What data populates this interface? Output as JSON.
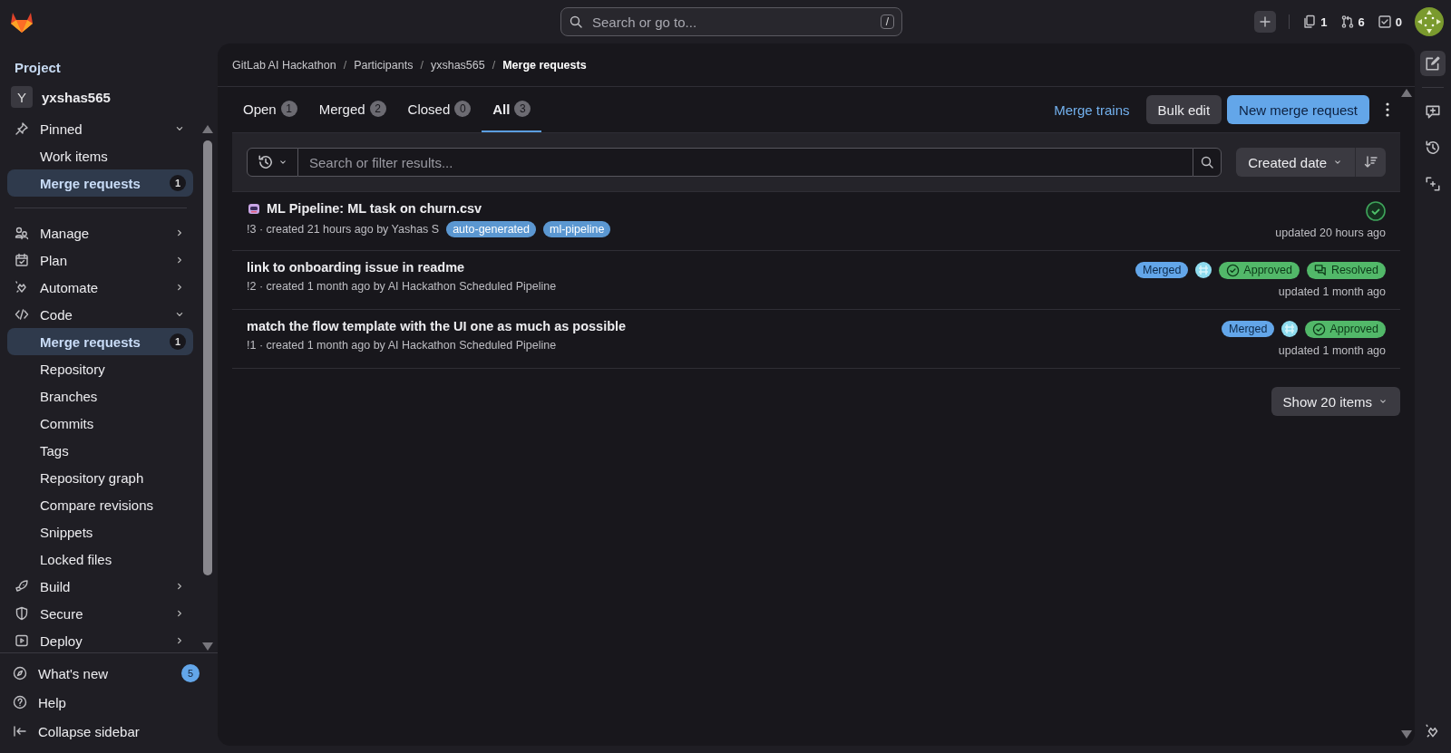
{
  "search": {
    "placeholder": "Search or go to...",
    "shortcut": "/"
  },
  "top_counts": [
    {
      "kind": "issues",
      "count": "1"
    },
    {
      "kind": "merge",
      "count": "6"
    },
    {
      "kind": "todo",
      "count": "0"
    }
  ],
  "sidebar": {
    "title": "Project",
    "project": {
      "initial": "Y",
      "name": "yxshas565"
    },
    "items": [
      {
        "kind": "section",
        "label": "Pinned",
        "expanded": true,
        "children": [
          {
            "label": "Work items",
            "selected": false
          },
          {
            "label": "Merge requests",
            "selected": true,
            "badge": "1"
          }
        ]
      },
      {
        "kind": "divider"
      },
      {
        "kind": "section",
        "label": "Manage",
        "expanded": false
      },
      {
        "kind": "section",
        "label": "Plan",
        "expanded": false
      },
      {
        "kind": "section",
        "label": "Automate",
        "expanded": false
      },
      {
        "kind": "section",
        "label": "Code",
        "expanded": true,
        "children": [
          {
            "label": "Merge requests",
            "selected": true,
            "badge": "1"
          },
          {
            "label": "Repository",
            "selected": false
          },
          {
            "label": "Branches",
            "selected": false
          },
          {
            "label": "Commits",
            "selected": false
          },
          {
            "label": "Tags",
            "selected": false
          },
          {
            "label": "Repository graph",
            "selected": false
          },
          {
            "label": "Compare revisions",
            "selected": false
          },
          {
            "label": "Snippets",
            "selected": false
          },
          {
            "label": "Locked files",
            "selected": false
          }
        ]
      },
      {
        "kind": "section",
        "label": "Build",
        "expanded": false
      },
      {
        "kind": "section",
        "label": "Secure",
        "expanded": false
      },
      {
        "kind": "section",
        "label": "Deploy",
        "expanded": false
      }
    ],
    "footer": [
      {
        "label": "What's new",
        "badge": "5"
      },
      {
        "label": "Help"
      },
      {
        "label": "Collapse sidebar"
      }
    ]
  },
  "breadcrumbs": {
    "separator": "/",
    "items": [
      "GitLab AI Hackathon",
      "Participants",
      "yxshas565",
      "Merge requests"
    ]
  },
  "tabs": [
    {
      "label": "Open",
      "count": "1",
      "selected": false
    },
    {
      "label": "Merged",
      "count": "2",
      "selected": false
    },
    {
      "label": "Closed",
      "count": "0",
      "selected": false
    },
    {
      "label": "All",
      "count": "3",
      "selected": true
    }
  ],
  "actions": {
    "link": "Merge trains",
    "secondary": "Bulk edit",
    "primary": "New merge request"
  },
  "filter": {
    "placeholder": "Search or filter results...",
    "sort": "Created date"
  },
  "merge_requests": [
    {
      "title": "ML Pipeline: ML task on churn.csv",
      "bot_icon": true,
      "meta": "!3 · created 21 hours ago by Yashas S",
      "labels": [
        "auto-generated",
        "ml-pipeline"
      ],
      "badges": [
        {
          "kind": "pipeline"
        }
      ],
      "updated": "updated 20 hours ago"
    },
    {
      "title": "link to onboarding issue in readme",
      "bot_icon": false,
      "meta": "!2 · created 1 month ago by AI Hackathon Scheduled Pipeline",
      "badges": [
        {
          "kind": "merged",
          "text": "Merged"
        },
        {
          "kind": "avatar"
        },
        {
          "kind": "approved",
          "text": "Approved"
        },
        {
          "kind": "resolved",
          "text": "Resolved"
        }
      ],
      "updated": "updated 1 month ago"
    },
    {
      "title": "match the flow template with the UI one as much as possible",
      "bot_icon": false,
      "meta": "!1 · created 1 month ago by AI Hackathon Scheduled Pipeline",
      "badges": [
        {
          "kind": "merged",
          "text": "Merged"
        },
        {
          "kind": "avatar"
        },
        {
          "kind": "approved",
          "text": "Approved"
        }
      ],
      "updated": "updated 1 month ago"
    }
  ],
  "pagination": "Show 20 items"
}
